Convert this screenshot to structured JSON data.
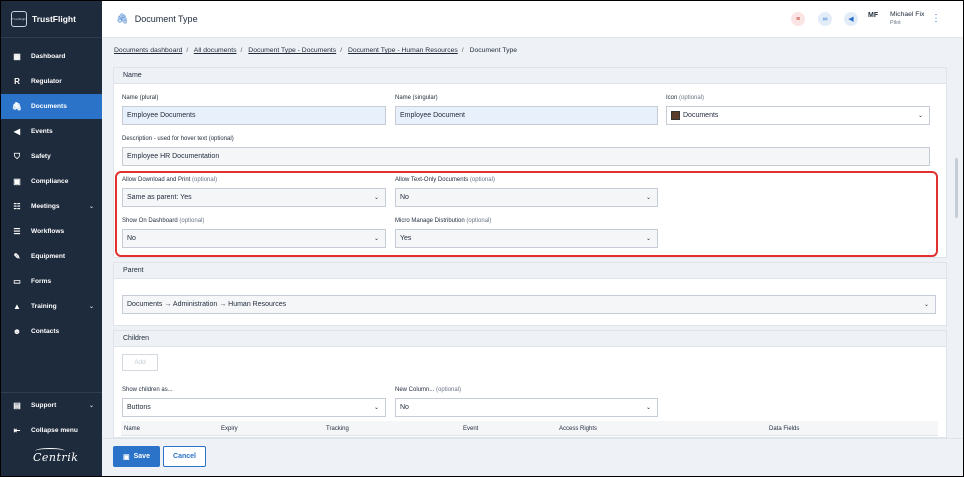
{
  "brand": {
    "name": "TrustFlight",
    "logo_text": "TrustFlight"
  },
  "sidebar": {
    "items": [
      {
        "label": "Dashboard",
        "icon": "dashboard-icon",
        "glyph": "▦"
      },
      {
        "label": "Regulator",
        "icon": "regulator-icon",
        "glyph": "R"
      },
      {
        "label": "Documents",
        "icon": "paperclip-icon",
        "glyph": "🖇"
      },
      {
        "label": "Events",
        "icon": "megaphone-icon",
        "glyph": "◀"
      },
      {
        "label": "Safety",
        "icon": "shield-icon",
        "glyph": "⛉"
      },
      {
        "label": "Compliance",
        "icon": "compliance-icon",
        "glyph": "▣"
      },
      {
        "label": "Meetings",
        "icon": "meetings-icon",
        "glyph": "☷"
      },
      {
        "label": "Workflows",
        "icon": "workflow-icon",
        "glyph": "☰"
      },
      {
        "label": "Equipment",
        "icon": "wrench-icon",
        "glyph": "✎"
      },
      {
        "label": "Forms",
        "icon": "forms-icon",
        "glyph": "▭"
      },
      {
        "label": "Training",
        "icon": "graduation-cap-icon",
        "glyph": "▲"
      },
      {
        "label": "Contacts",
        "icon": "contacts-icon",
        "glyph": "☻"
      }
    ],
    "bottom": [
      {
        "label": "Support",
        "icon": "support-icon",
        "glyph": "▤"
      },
      {
        "label": "Collapse menu",
        "icon": "collapse-icon",
        "glyph": "⇤"
      }
    ],
    "footer_logo": "Centrik"
  },
  "header": {
    "title": "Document Type",
    "user_initials": "MF",
    "user_name": "Michael Fix",
    "user_role": "Pilot"
  },
  "breadcrumb": [
    "Documents dashboard",
    "All documents",
    "Document Type - Documents",
    "Document Type - Human Resources",
    "Document Type"
  ],
  "name_panel": {
    "heading": "Name",
    "plural_label": "Name (plural)",
    "plural_value": "Employee Documents",
    "singular_label": "Name (singular)",
    "singular_value": "Employee Document",
    "icon_label": "Icon",
    "icon_optional": "(optional)",
    "icon_value": "Documents",
    "desc_label": "Description - used for hover text (optional)",
    "desc_optional": "(optional)",
    "desc_value": "Employee HR Documentation",
    "download_label": "Allow Download and Print",
    "download_optional": "(optional)",
    "download_value": "Same as parent: Yes",
    "textonly_label": "Allow Text-Only Documents",
    "textonly_optional": "(optional)",
    "textonly_value": "No",
    "dashboard_label": "Show On Dashboard",
    "dashboard_optional": "(optional)",
    "dashboard_value": "No",
    "micro_label": "Micro Manage Distribution",
    "micro_optional": "(optional)",
    "micro_value": "Yes"
  },
  "parent_panel": {
    "heading": "Parent",
    "value": "Documents → Administration → Human Resources"
  },
  "children_panel": {
    "heading": "Children",
    "add_label": "Add",
    "show_label": "Show children as...",
    "show_value": "Buttons",
    "newcol_label": "New Column...",
    "newcol_optional": "(optional)",
    "newcol_value": "No",
    "columns": [
      "Name",
      "Expiry",
      "Tracking",
      "Event",
      "Access Rights",
      "Data Fields"
    ]
  },
  "footer": {
    "save_label": "Save",
    "cancel_label": "Cancel"
  }
}
